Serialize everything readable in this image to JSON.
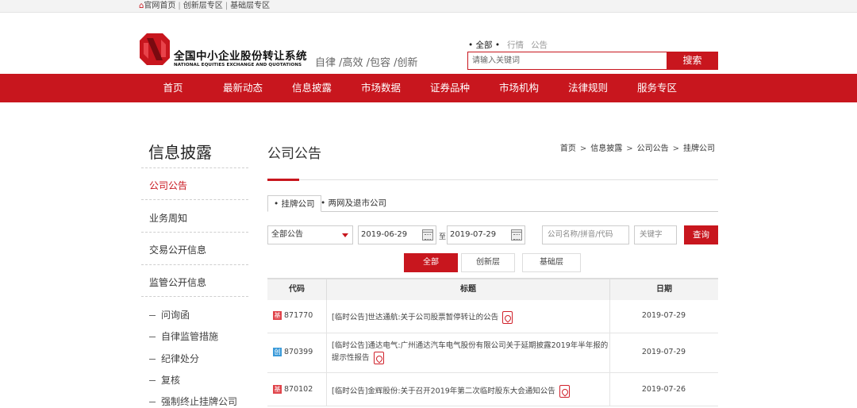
{
  "topbar": {
    "links": [
      "官网首页",
      "创新层专区",
      "基础层专区"
    ],
    "separator": "|"
  },
  "brand": {
    "cn": "全国中小企业股份转让系统",
    "en": "NATIONAL EQUITIES EXCHANGE AND QUOTATIONS",
    "slogan": "自律 /高效 /包容 /创新"
  },
  "search": {
    "tabs": [
      "• 全部 •",
      "行情",
      "公告"
    ],
    "placeholder": "请输入关键词",
    "button": "搜索"
  },
  "nav": {
    "items": [
      "首页",
      "最新动态",
      "信息披露",
      "市场数据",
      "证券品种",
      "市场机构",
      "法律规则",
      "服务专区"
    ]
  },
  "sidebar": {
    "title": "信息披露",
    "items": [
      "公司公告",
      "业务周知",
      "交易公开信息",
      "监管公开信息"
    ],
    "subitems": [
      "问询函",
      "自律监管措施",
      "纪律处分",
      "复核",
      "强制终止挂牌公司"
    ]
  },
  "main": {
    "title": "公司公告",
    "breadcrumb": [
      "首页",
      "信息披露",
      "公司公告",
      "挂牌公司"
    ],
    "crumb_sep": ">",
    "subtabs": [
      "• 挂牌公司",
      "• 两网及退市公司"
    ]
  },
  "filters": {
    "type_select": "全部公告",
    "date_from": "2019-06-29",
    "to_label": "至",
    "date_to": "2019-07-29",
    "company_placeholder": "公司名称/拼音/代码",
    "keyword_placeholder": "关键字",
    "query_button": "查询",
    "tier_tabs": [
      "全部",
      "创新层",
      "基础层"
    ]
  },
  "table": {
    "headers": [
      "代码",
      "标题",
      "日期"
    ],
    "rows": [
      {
        "tag": "基",
        "code": "871770",
        "title": "[临时公告]世达通航:关于公司股票暂停转让的公告",
        "date": "2019-07-29"
      },
      {
        "tag": "创",
        "code": "870399",
        "title": "[临时公告]通达电气:广州通达汽车电气股份有限公司关于延期披露2019年半年报的提示性报告",
        "date": "2019-07-29"
      },
      {
        "tag": "基",
        "code": "870102",
        "title": "[临时公告]金辉股份:关于召开2019年第二次临时股东大会通知公告",
        "date": "2019-07-26"
      }
    ]
  },
  "colors": {
    "brand_red": "#c8161e",
    "tag_blue": "#3a9ad9"
  }
}
